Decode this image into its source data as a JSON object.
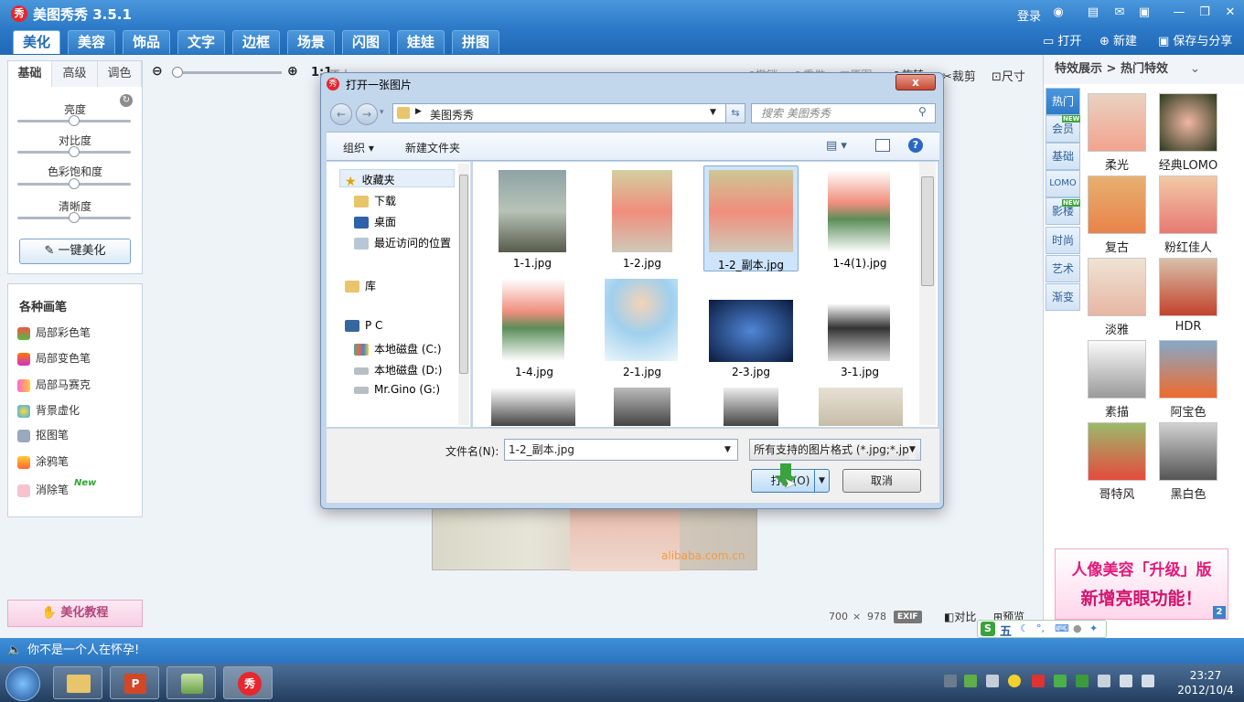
{
  "app": {
    "title": "美图秀秀 3.5.1",
    "logo_char": "秀"
  },
  "titlebar_right": {
    "login": "登录"
  },
  "tabs": [
    "美化",
    "美容",
    "饰品",
    "文字",
    "边框",
    "场景",
    "闪图",
    "娃娃",
    "拼图"
  ],
  "header_actions": {
    "open": "打开",
    "new": "新建",
    "save": "保存与分享"
  },
  "left": {
    "subtabs": [
      "基础",
      "高级",
      "调色"
    ],
    "sliders": [
      "亮度",
      "对比度",
      "色彩饱和度",
      "清晰度"
    ],
    "beautify_button": "一键美化",
    "brush_title": "各种画笔",
    "brushes": [
      "局部彩色笔",
      "局部变色笔",
      "局部马赛克",
      "背景虚化",
      "抠图笔",
      "涂鸦笔",
      "消除笔"
    ],
    "new_badge": "New",
    "tutorial": "美化教程"
  },
  "toolbar": {
    "zoom_ratio": "1:1",
    "zoom_suffix": "原大",
    "buttons": [
      "撤销",
      "重做",
      "原图",
      "旋转",
      "裁剪",
      "尺寸"
    ]
  },
  "canvas": {
    "watermark": "alibaba.com.cn",
    "dims_w": "700",
    "dims_x": "×",
    "dims_h": "978",
    "exif": "EXIF",
    "compare": "对比",
    "preview": "预览"
  },
  "right": {
    "breadcrumb_a": "特效展示",
    "breadcrumb_sep": ">",
    "breadcrumb_b": "热门特效",
    "vtabs": [
      "热门",
      "会员",
      "基础",
      "LOMO",
      "影楼",
      "时尚",
      "艺术",
      "渐变"
    ],
    "new_tag": "NEW",
    "effects": [
      "柔光",
      "经典LOMO",
      "复古",
      "粉红佳人",
      "淡雅",
      "HDR",
      "素描",
      "阿宝色",
      "哥特风",
      "黑白色"
    ],
    "ad_line1": "人像美容「升级」版",
    "ad_line2": "新增亮眼功能！",
    "ad_page": "2"
  },
  "dialog": {
    "title": "打开一张图片",
    "close": "x",
    "address": "美图秀秀",
    "search_placeholder": "搜索 美图秀秀",
    "organize": "组织",
    "new_folder": "新建文件夹",
    "nav": {
      "favorites": "收藏夹",
      "downloads": "下载",
      "desktop": "桌面",
      "recent": "最近访问的位置",
      "library": "库",
      "pc": "P C",
      "disk_c": "本地磁盘 (C:)",
      "disk_d": "本地磁盘 (D:)",
      "disk_g": "Mr.Gino (G:)"
    },
    "files": [
      "1-1.jpg",
      "1-2.jpg",
      "1-2_副本.jpg",
      "1-4(1).jpg",
      "1-4.jpg",
      "2-1.jpg",
      "2-3.jpg",
      "3-1.jpg"
    ],
    "filename_label": "文件名(N):",
    "filename_value": "1-2_副本.jpg",
    "filetype": "所有支持的图片格式 (*.jpg;*.jp",
    "open_button": "打开(O)",
    "cancel_button": "取消"
  },
  "statusbar": {
    "message": "你不是一个人在怀孕!"
  },
  "taskbar": {
    "time": "23:27",
    "date": "2012/10/4"
  },
  "ime": {
    "label": "五"
  },
  "colors": {
    "brand_blue": "#2d7ac8",
    "tab_active_text": "#1f68b5",
    "pink_accent": "#e21a7b",
    "close_red": "#c44b34"
  }
}
